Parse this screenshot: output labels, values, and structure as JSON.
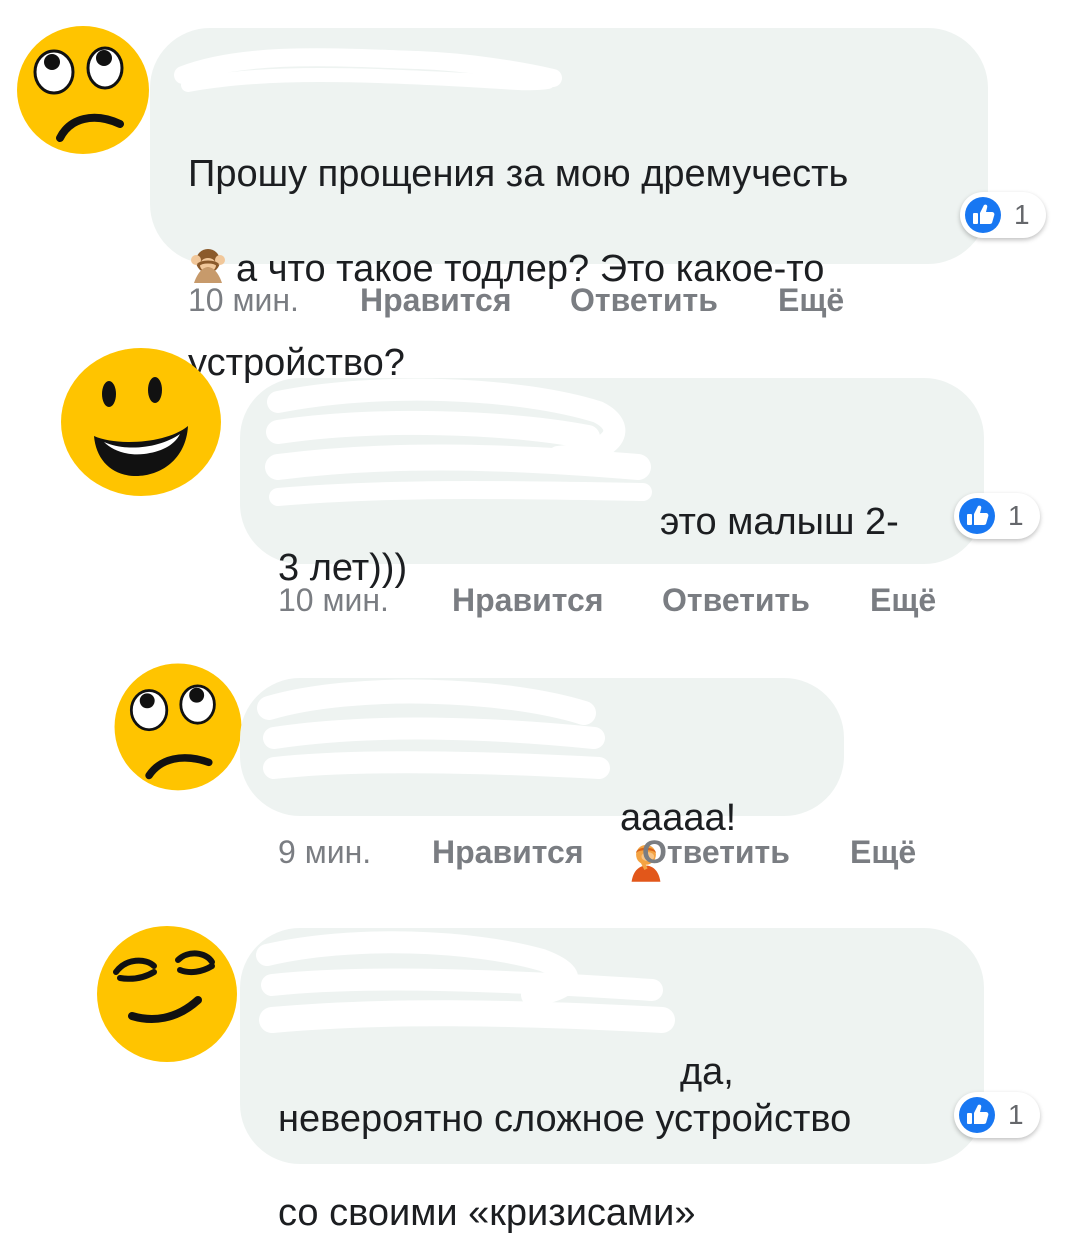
{
  "colors": {
    "bubble": "#eef3f1",
    "like_blue": "#1877f2",
    "avatar_yellow": "#ffc400",
    "meta_gray": "#7a7d82"
  },
  "comments": [
    {
      "avatar_icon": "eye-roll-face-icon",
      "text_line1": "Прошу прощения за мою дремучесть",
      "text_line2": "а что такое тодлер? Это какое-то",
      "text_line3": "устройство?",
      "inline_emoji": "see-no-evil-monkey-icon",
      "likes": "1",
      "time": "10 мин.",
      "like_label": "Нравится",
      "reply_label": "Ответить",
      "more_label": "Ещё"
    },
    {
      "avatar_icon": "grinning-face-icon",
      "text_line1": "это малыш 2-",
      "text_line2": "3 лет)))",
      "likes": "1",
      "time": "10 мин.",
      "like_label": "Нравится",
      "reply_label": "Ответить",
      "more_label": "Ещё"
    },
    {
      "avatar_icon": "eye-roll-face-icon",
      "text_line1": "ааааа!",
      "inline_emoji": "facepalm-person-icon",
      "time": "9 мин.",
      "like_label": "Нравится",
      "reply_label": "Ответить",
      "more_label": "Ещё"
    },
    {
      "avatar_icon": "smirking-face-icon",
      "text_line1": "да,",
      "text_line2": "невероятно сложное устройство",
      "text_line3": "со своими «кризисами»",
      "likes": "1"
    }
  ]
}
